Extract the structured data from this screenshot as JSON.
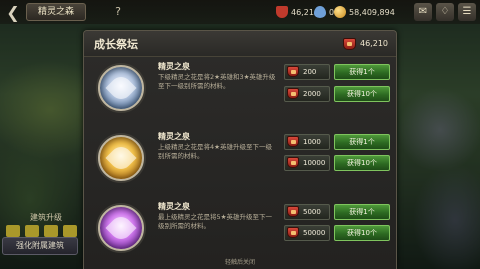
{
  "topbar": {
    "title": "精灵之森",
    "help": "?",
    "resources": [
      {
        "icon": "red-gem-icon",
        "value": "46,210"
      },
      {
        "icon": "blue-drop-icon",
        "value": "0"
      },
      {
        "icon": "gold-coin-icon",
        "value": "58,409,894"
      }
    ]
  },
  "left_panel": {
    "label": "建筑升级",
    "button": "强化附属建筑"
  },
  "modal": {
    "title": "成长祭坛",
    "total": "46,210",
    "entries": [
      {
        "name": "精灵之泉",
        "icon": "silver-flower-icon",
        "desc": "下级精灵之花是将2★英雄和3★英雄升级至下一级别所需的材料。",
        "options": [
          {
            "cost": "200",
            "button": "获得1个"
          },
          {
            "cost": "2000",
            "button": "获得10个"
          }
        ]
      },
      {
        "name": "精灵之泉",
        "icon": "gold-flower-icon",
        "desc": "上级精灵之花是将4★英雄升级至下一级别所需的材料。",
        "options": [
          {
            "cost": "1000",
            "button": "获得1个"
          },
          {
            "cost": "10000",
            "button": "获得10个"
          }
        ]
      },
      {
        "name": "精灵之泉",
        "icon": "purple-flower-icon",
        "desc": "最上级精灵之花是将5★英雄升级至下一级别所需的材料。",
        "options": [
          {
            "cost": "5000",
            "button": "获得1个"
          },
          {
            "cost": "50000",
            "button": "获得10个"
          }
        ]
      }
    ]
  },
  "footer": "轻触后关闭"
}
